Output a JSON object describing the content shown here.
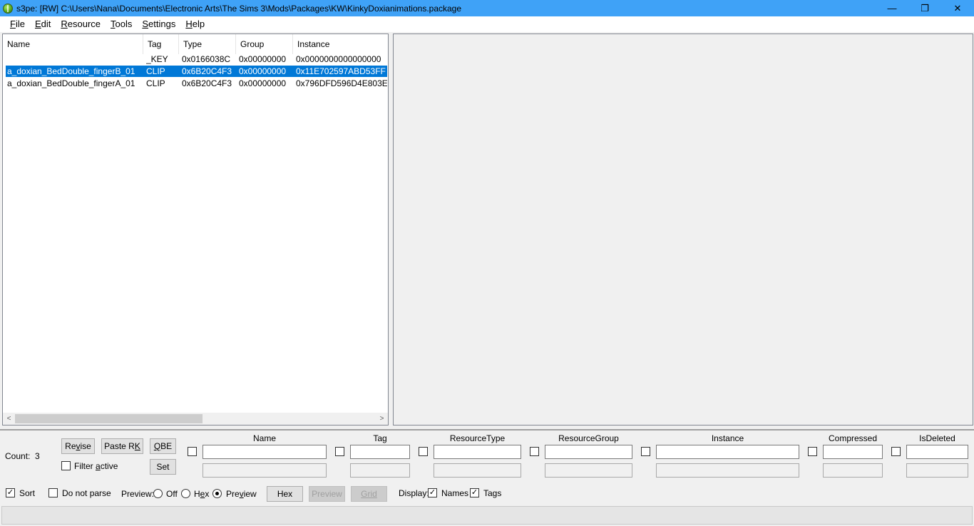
{
  "window": {
    "title": "s3pe: [RW] C:\\Users\\Nana\\Documents\\Electronic Arts\\The Sims 3\\Mods\\Packages\\KW\\KinkyDoxianimations.package",
    "minimize_glyph": "—",
    "maximize_glyph": "❐",
    "close_glyph": "✕"
  },
  "menu": [
    {
      "accel": "F",
      "rest": "ile"
    },
    {
      "accel": "E",
      "rest": "dit"
    },
    {
      "accel": "R",
      "rest": "esource"
    },
    {
      "accel": "T",
      "rest": "ools"
    },
    {
      "accel": "S",
      "rest": "ettings"
    },
    {
      "accel": "H",
      "rest": "elp"
    }
  ],
  "list": {
    "columns": [
      "Name",
      "Tag",
      "Type",
      "Group",
      "Instance"
    ],
    "rows": [
      {
        "name": "",
        "tag": "_KEY",
        "type": "0x0166038C",
        "group": "0x00000000",
        "instance": "0x0000000000000000",
        "selected": false
      },
      {
        "name": "a_doxian_BedDouble_fingerB_01",
        "tag": "CLIP",
        "type": "0x6B20C4F3",
        "group": "0x00000000",
        "instance": "0x11E702597ABD53FF",
        "selected": true
      },
      {
        "name": "a_doxian_BedDouble_fingerA_01",
        "tag": "CLIP",
        "type": "0x6B20C4F3",
        "group": "0x00000000",
        "instance": "0x796DFD596D4E803E",
        "selected": false
      }
    ],
    "scroll_left_glyph": "<",
    "scroll_right_glyph": ">",
    "scroll_thumb_fraction": 0.52
  },
  "filter": {
    "count_label": "Count:",
    "count_value": "3",
    "revise": {
      "pre": "Re",
      "accel": "v",
      "post": "ise"
    },
    "paste_rk": {
      "pre": "Paste R",
      "accel": "K",
      "post": ""
    },
    "qbe": {
      "pre": "",
      "accel": "Q",
      "post": "BE"
    },
    "set_label": "Set",
    "filter_active": {
      "pre": "Filter ",
      "accel": "a",
      "post": "ctive"
    },
    "columns": {
      "name": "Name",
      "tag": "Tag",
      "resource_type": "ResourceType",
      "resource_group": "ResourceGroup",
      "instance": "Instance",
      "compressed": "Compressed",
      "is_deleted": "IsDeleted"
    }
  },
  "options": {
    "sort_label": "Sort",
    "sort_checked": "✓",
    "do_not_parse_label": "Do not parse",
    "preview_label": "Preview:",
    "preview_off": "Off",
    "preview_hex": {
      "pre": "H",
      "accel": "e",
      "post": "x"
    },
    "preview_preview": {
      "pre": "Pre",
      "accel": "v",
      "post": "iew"
    },
    "preview_selected": "Preview",
    "hex_button": "Hex",
    "preview_button": "Preview",
    "grid_button": "Grid",
    "display_label": "Display:",
    "names_label": "Names",
    "names_checked": "✓",
    "tags_label": "Tags",
    "tags_checked": "✓"
  }
}
